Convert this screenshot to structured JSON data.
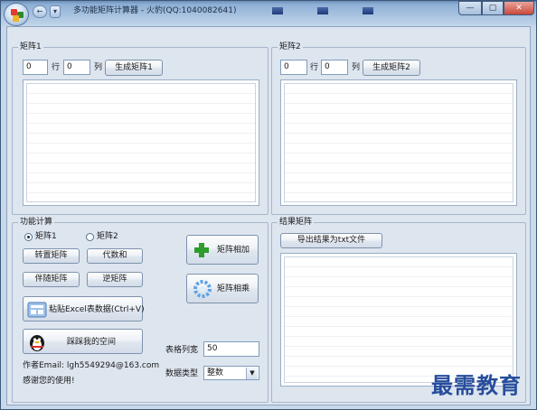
{
  "window": {
    "title": "多功能矩阵计算器 - 火豹(QQ:1040082641)",
    "qat_back": "←",
    "qat_down": "▾",
    "sys_min": "—",
    "sys_max": "▢",
    "sys_close": "✕"
  },
  "matrix1": {
    "legend": "矩阵1",
    "rows_value": "0",
    "rows_label": "行",
    "cols_value": "0",
    "cols_label": "列",
    "generate_label": "生成矩阵1"
  },
  "matrix2": {
    "legend": "矩阵2",
    "rows_value": "0",
    "rows_label": "行",
    "cols_value": "0",
    "cols_label": "列",
    "generate_label": "生成矩阵2"
  },
  "functions": {
    "legend": "功能计算",
    "radio_matrix1": "矩阵1",
    "radio_matrix2": "矩阵2",
    "selected": "矩阵1",
    "transpose_label": "转置矩阵",
    "cofactor_label": "代数和",
    "adjugate_label": "伴随矩阵",
    "inverse_label": "逆矩阵",
    "add_label": "矩阵相加",
    "multiply_label": "矩阵相乘",
    "paste_label": "粘贴Excel表数据(Ctrl+V)",
    "space_label": "踩踩我的空间",
    "col_width_label": "表格列宽",
    "col_width_value": "50",
    "data_type_label": "数据类型",
    "data_type_value": "整数",
    "author_text": "作者Email: lgh5549294@163.com",
    "thanks_text": "感谢您的使用!"
  },
  "result": {
    "legend": "结果矩阵",
    "export_label": "导出结果为txt文件"
  },
  "watermark": "最需教育",
  "icons": {
    "add": "plus-icon",
    "multiply": "spinner-icon",
    "paste": "excel-icon",
    "space": "qq-penguin-icon"
  },
  "colors": {
    "accent_green": "#2e9d2e",
    "watermark": "#274d9c"
  }
}
